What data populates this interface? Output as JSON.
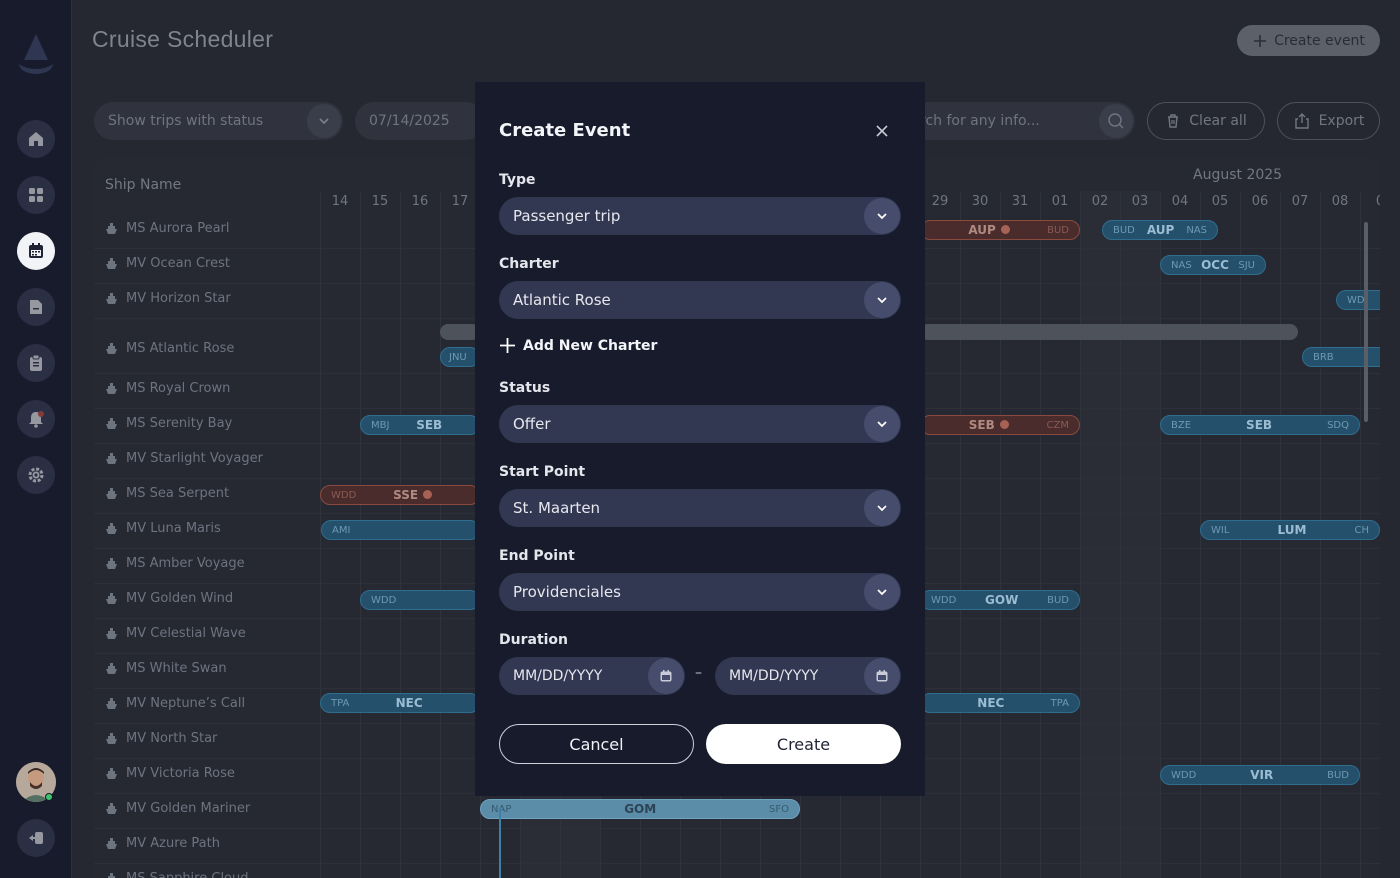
{
  "header": {
    "title": "Cruise Scheduler",
    "create_event_label": "Create event"
  },
  "filters": {
    "status_placeholder": "Show trips with status",
    "date_value": "07/14/2025",
    "search_placeholder": "rch for any info...",
    "clear_label": "Clear all",
    "export_label": "Export"
  },
  "schedule": {
    "ship_column_header": "Ship Name",
    "month_label": "August 2025",
    "days_left": [
      "14",
      "15",
      "16",
      "17"
    ],
    "days_right": [
      "29",
      "30",
      "31",
      "01",
      "02",
      "03",
      "04",
      "05",
      "06",
      "07",
      "08",
      "0"
    ],
    "ships": [
      "MS Aurora Pearl",
      "MV Ocean Crest",
      "MV Horizon Star",
      "MS Atlantic Rose",
      "MS Royal Crown",
      "MS Serenity Bay",
      "MV Starlight Voyager",
      "MS Sea Serpent",
      "MV Luna Maris",
      "MS Amber Voyage",
      "MV Golden Wind",
      "MV Celestial Wave",
      "MS White Swan",
      "MV Neptune’s Call",
      "MV North Star",
      "MV Victoria Rose",
      "MV Golden Mariner",
      "MV Azure Path",
      "MS Sapphire Cloud"
    ],
    "trips": {
      "aup1": {
        "from": "",
        "code": "AUP",
        "to": "BUD"
      },
      "aup2": {
        "from": "BUD",
        "code": "AUP",
        "to": "NAS"
      },
      "occ": {
        "from": "NAS",
        "code": "OCC",
        "to": "SJU"
      },
      "wd_horizon": {
        "from": "WD",
        "code": "",
        "to": ""
      },
      "jnu": {
        "from": "JNU",
        "code": "",
        "to": ""
      },
      "brb": {
        "from": "BRB",
        "code": "",
        "to": ""
      },
      "seb1": {
        "from": "MBJ",
        "code": "SEB",
        "to": ""
      },
      "seb2": {
        "from": "",
        "code": "SEB",
        "to": "CZM"
      },
      "seb3": {
        "from": "BZE",
        "code": "SEB",
        "to": "SDQ"
      },
      "sse": {
        "from": "WDD",
        "code": "SSE",
        "to": ""
      },
      "lum1": {
        "from": "AMI",
        "code": "",
        "to": ""
      },
      "lum2": {
        "from": "WIL",
        "code": "LUM",
        "to": "CH"
      },
      "gow1": {
        "from": "WDD",
        "code": "",
        "to": ""
      },
      "gow2": {
        "from": "WDD",
        "code": "GOW",
        "to": "BUD"
      },
      "nec1": {
        "from": "TPA",
        "code": "NEC",
        "to": ""
      },
      "nec2": {
        "from": "",
        "code": "NEC",
        "to": "TPA"
      },
      "vir": {
        "from": "WDD",
        "code": "VIR",
        "to": "BUD"
      },
      "gom": {
        "from": "NAP",
        "code": "GOM",
        "to": "SFO"
      }
    }
  },
  "modal": {
    "title": "Create Event",
    "type_label": "Type",
    "type_value": "Passenger trip",
    "charter_label": "Charter",
    "charter_value": "Atlantic Rose",
    "add_charter_label": "Add New Charter",
    "status_label": "Status",
    "status_value": "Offer",
    "start_label": "Start Point",
    "start_value": "St. Maarten",
    "end_label": "End Point",
    "end_value": "Providenciales",
    "duration_label": "Duration",
    "start_date_placeholder": "MM/DD/YYYY",
    "end_date_placeholder": "MM/DD/YYYY",
    "date_separator": "–",
    "cancel_label": "Cancel",
    "create_label": "Create"
  },
  "icons": {
    "nav": [
      "home-icon",
      "dashboard-icon",
      "calendar-icon",
      "folder-icon",
      "clipboard-icon",
      "notification-icon",
      "settings-icon"
    ],
    "logout": "logout-icon"
  },
  "colors": {
    "sidebar": "#171b2c",
    "modal": "#171b2c",
    "input": "#323752",
    "trip_blue": "#24506b",
    "trip_red": "#4a2c2c",
    "online": "#3ec46d"
  }
}
